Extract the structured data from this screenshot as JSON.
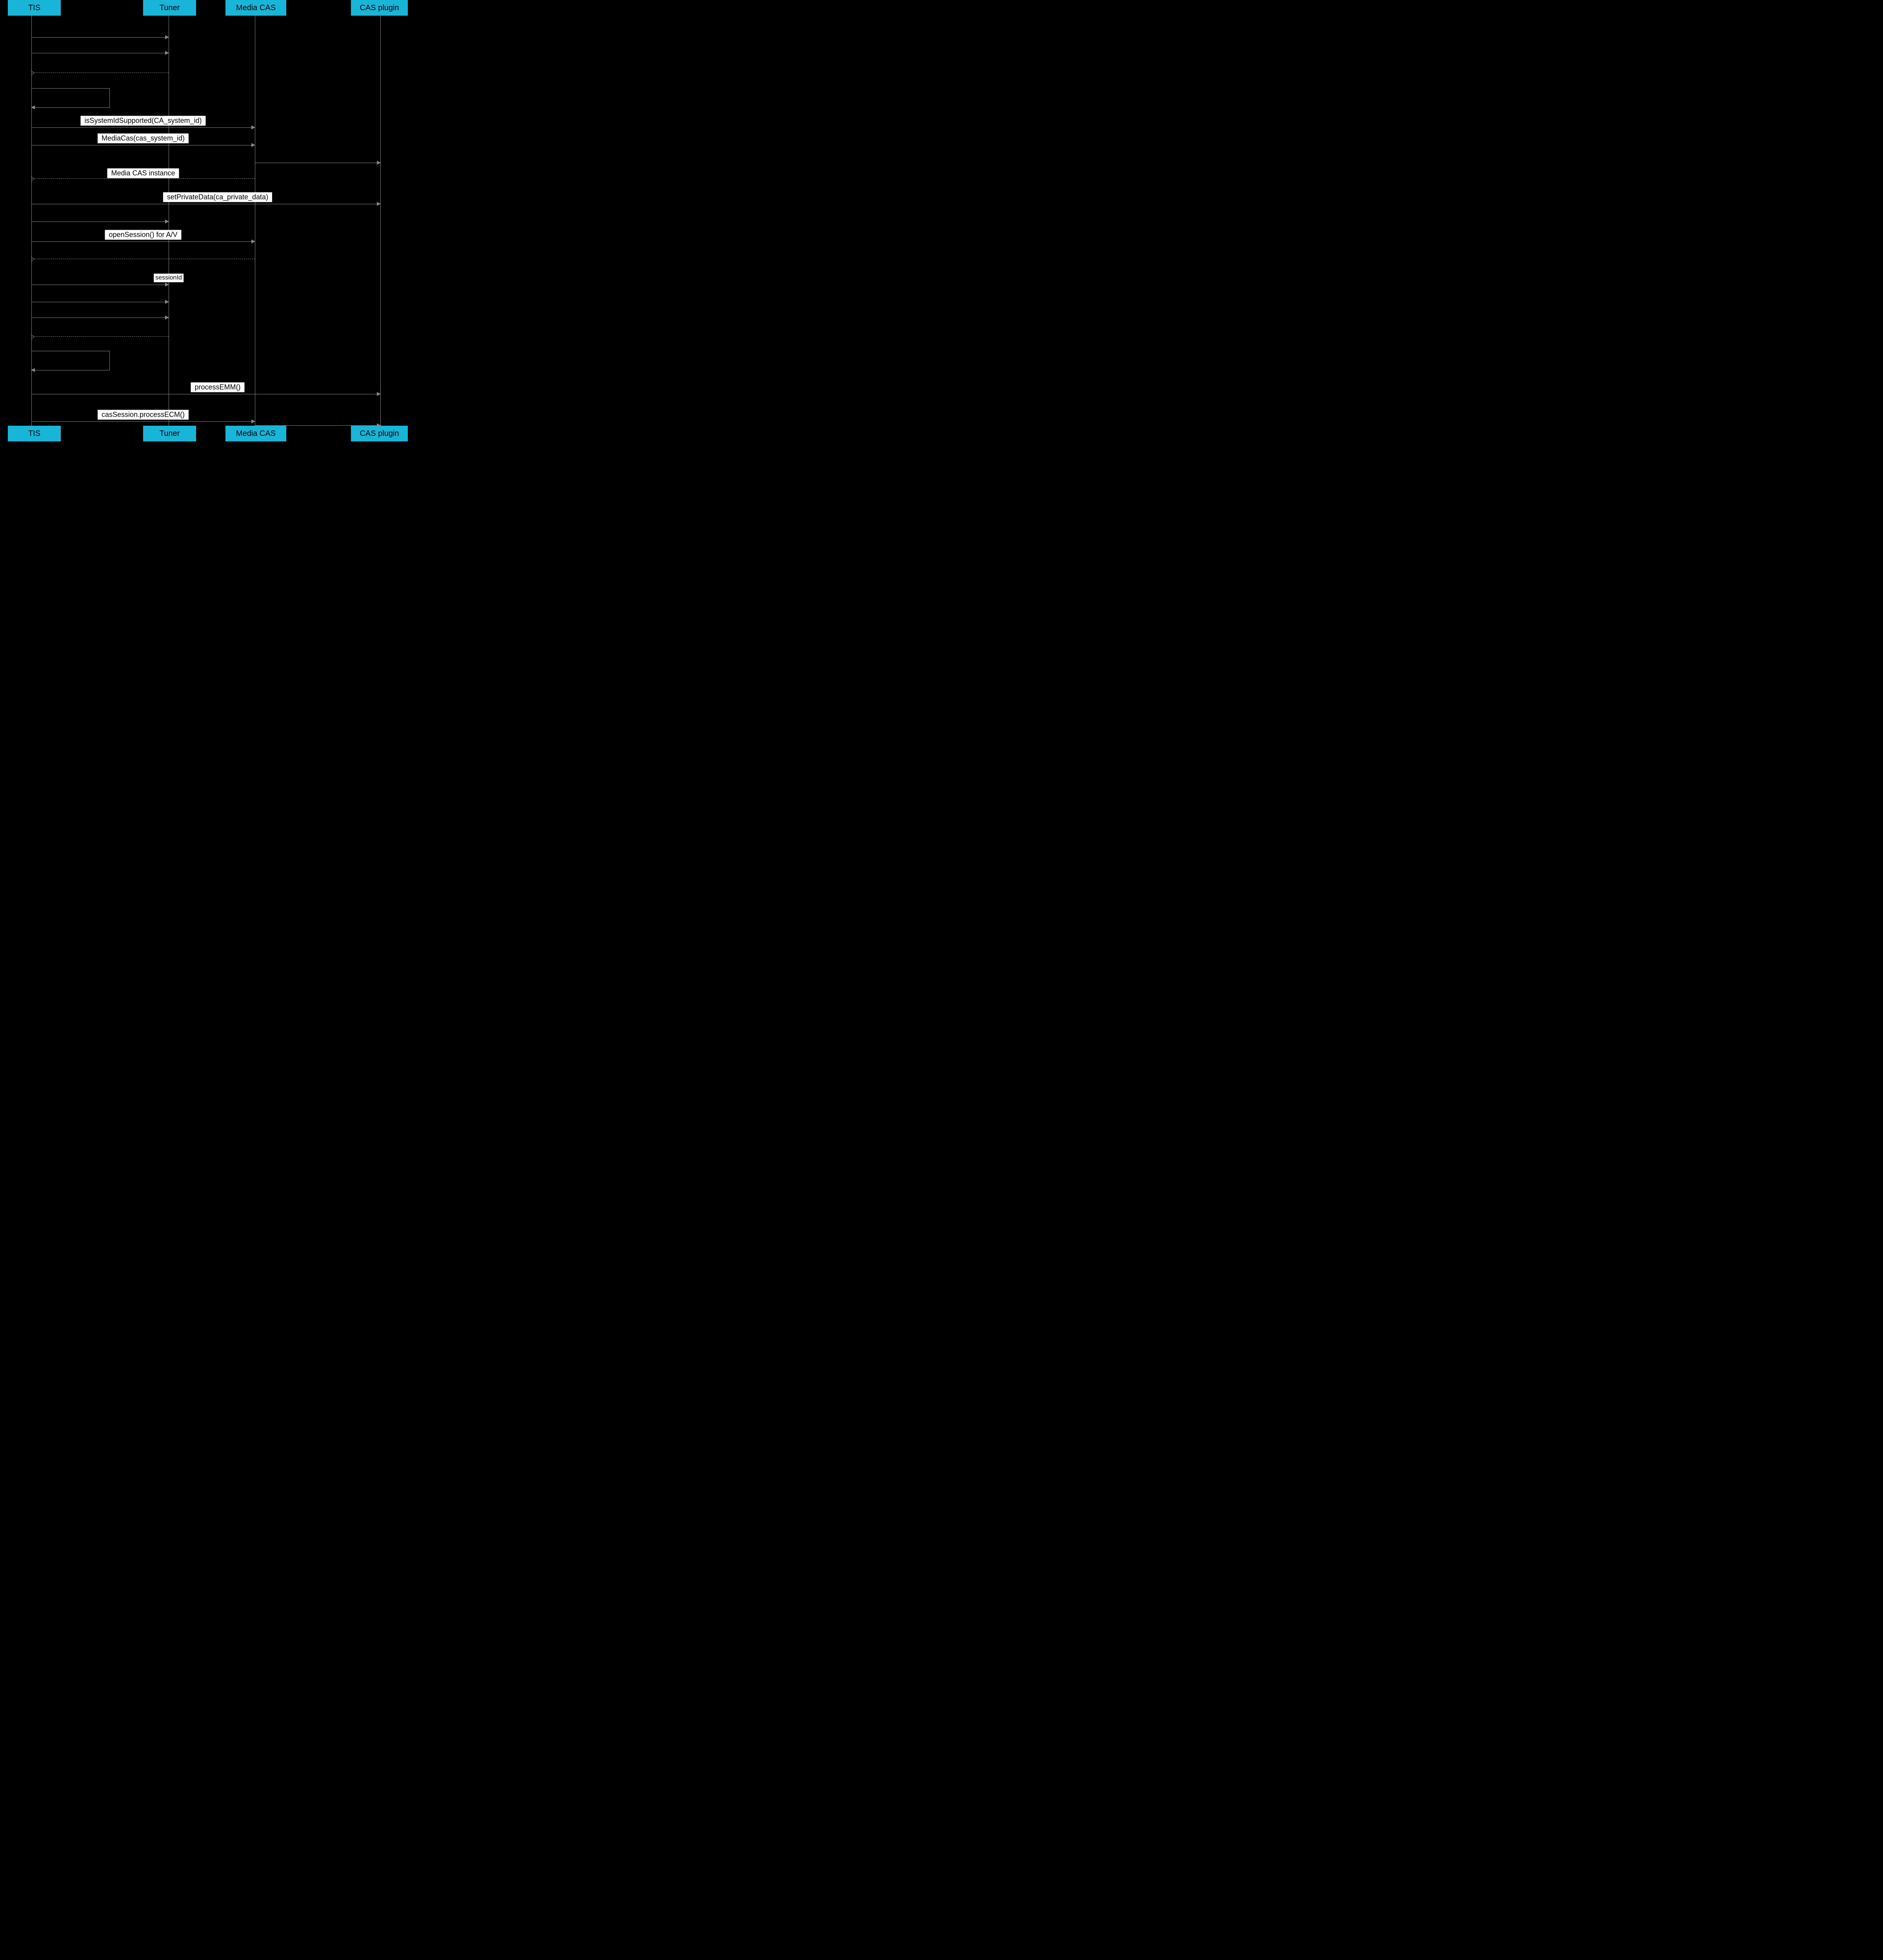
{
  "participants": {
    "tis": "TIS",
    "tuner": "Tuner",
    "mediacas": "Media CAS",
    "casplugin": "CAS plugin"
  },
  "messages": {
    "m1": "isSystemIdSupported(CA_system_id)",
    "m2": "MediaCas(cas_system_id)",
    "m3": "Media CAS instance",
    "m4": "setPrivateData(ca_private_data)",
    "m5": "openSession() for A/V",
    "m6": "sessionId",
    "m7": "processEMM()",
    "m8": "casSession.processECM()"
  }
}
